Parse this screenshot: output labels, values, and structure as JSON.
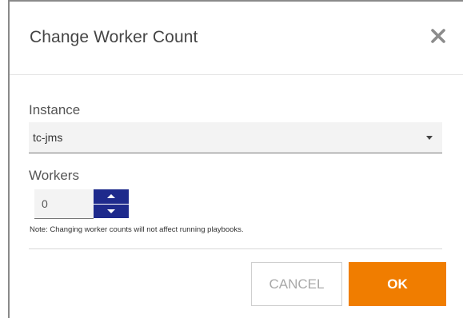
{
  "dialog": {
    "title": "Change Worker Count",
    "close_icon": "close-icon"
  },
  "instance": {
    "label": "Instance",
    "selected": "tc-jms"
  },
  "workers": {
    "label": "Workers",
    "value": "0"
  },
  "note": "Note: Changing worker counts will not affect running playbooks.",
  "buttons": {
    "cancel": "CANCEL",
    "ok": "OK"
  },
  "colors": {
    "accent": "#f07d00",
    "spinner": "#1e2a8c"
  }
}
